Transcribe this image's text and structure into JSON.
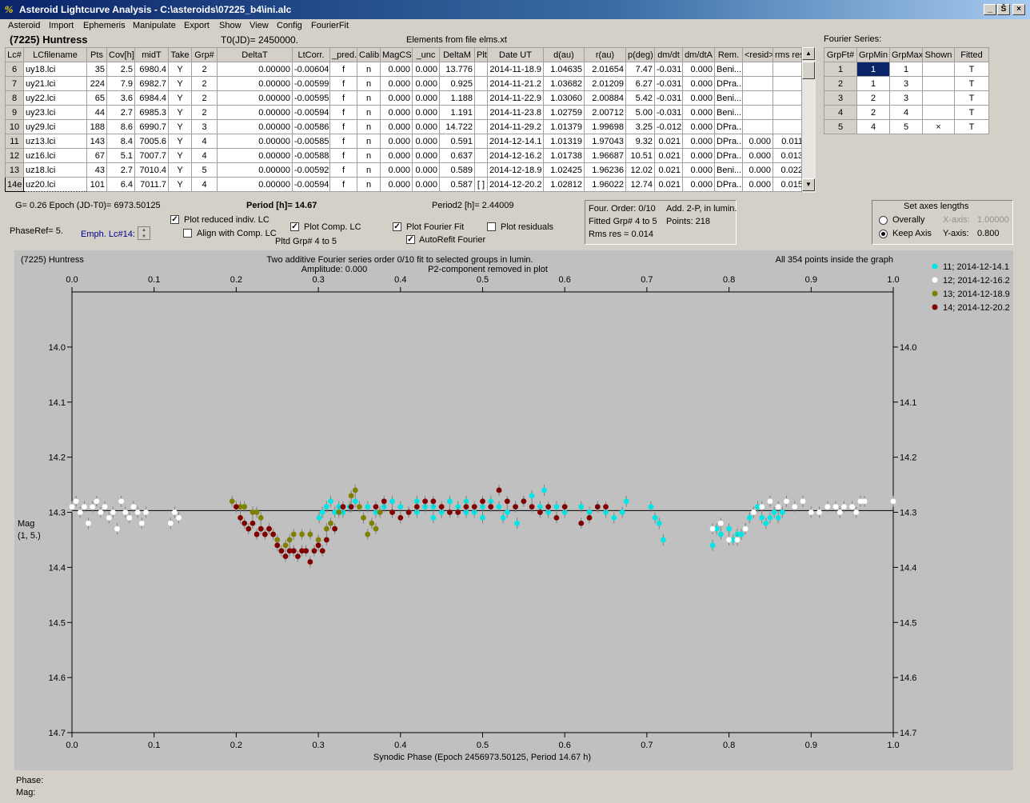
{
  "window": {
    "title": "Asteroid Lightcurve Analysis - C:\\asteroids\\07225_b4\\ini.alc",
    "icon": "app-icon",
    "controls": [
      "_",
      "Š",
      "×"
    ]
  },
  "menu": [
    "Asteroid",
    "Import",
    "Ephemeris",
    "Manipulate",
    "Export",
    "Show",
    "View",
    "Config",
    "FourierFit"
  ],
  "header": {
    "asteroid": "(7225) Huntress",
    "t0": "T0(JD)= 2450000.",
    "elements": "Elements from file elms.xt",
    "fourier_label": "Fourier Series:"
  },
  "lc_table": {
    "columns": [
      "Lc#",
      "LCfilename",
      "Pts",
      "Cov[h]",
      "midT",
      "Take",
      "Grp#",
      "DeltaT",
      "LtCorr.",
      "_pred.",
      "Calib.",
      "MagCS",
      "_unc",
      "DeltaM",
      "Plt",
      "Date UT",
      "d(au)",
      "r(au)",
      "p(deg)",
      "dm/dt",
      "dm/dtA",
      "Rem.",
      "<resid>",
      "rms res"
    ],
    "rows": [
      [
        "6",
        "uy18.lci",
        "35",
        "2.5",
        "6980.4",
        "Y",
        "2",
        "0.00000",
        "-0.00604",
        "f",
        "n",
        "0.000",
        "0.000",
        "13.776",
        "",
        "2014-11-18.9",
        "1.04635",
        "2.01654",
        "7.47",
        "-0.031",
        "0.000",
        "Beni...",
        "",
        ""
      ],
      [
        "7",
        "uy21.lci",
        "224",
        "7.9",
        "6982.7",
        "Y",
        "2",
        "0.00000",
        "-0.00599",
        "f",
        "n",
        "0.000",
        "0.000",
        "0.925",
        "",
        "2014-11-21.2",
        "1.03682",
        "2.01209",
        "6.27",
        "-0.031",
        "0.000",
        "DPra...",
        "",
        ""
      ],
      [
        "8",
        "uy22.lci",
        "65",
        "3.6",
        "6984.4",
        "Y",
        "2",
        "0.00000",
        "-0.00595",
        "f",
        "n",
        "0.000",
        "0.000",
        "1.188",
        "",
        "2014-11-22.9",
        "1.03060",
        "2.00884",
        "5.42",
        "-0.031",
        "0.000",
        "Beni...",
        "",
        ""
      ],
      [
        "9",
        "uy23.lci",
        "44",
        "2.7",
        "6985.3",
        "Y",
        "2",
        "0.00000",
        "-0.00594",
        "f",
        "n",
        "0.000",
        "0.000",
        "1.191",
        "",
        "2014-11-23.8",
        "1.02759",
        "2.00712",
        "5.00",
        "-0.031",
        "0.000",
        "Beni...",
        "",
        ""
      ],
      [
        "10",
        "uy29.lci",
        "188",
        "8.6",
        "6990.7",
        "Y",
        "3",
        "0.00000",
        "-0.00586",
        "f",
        "n",
        "0.000",
        "0.000",
        "14.722",
        "",
        "2014-11-29.2",
        "1.01379",
        "1.99698",
        "3.25",
        "-0.012",
        "0.000",
        "DPra...",
        "",
        ""
      ],
      [
        "11",
        "uz13.lci",
        "143",
        "8.4",
        "7005.6",
        "Y",
        "4",
        "0.00000",
        "-0.00585",
        "f",
        "n",
        "0.000",
        "0.000",
        "0.591",
        "",
        "2014-12-14.1",
        "1.01319",
        "1.97043",
        "9.32",
        "0.021",
        "0.000",
        "DPra...",
        "0.000",
        "0.011"
      ],
      [
        "12",
        "uz16.lci",
        "67",
        "5.1",
        "7007.7",
        "Y",
        "4",
        "0.00000",
        "-0.00588",
        "f",
        "n",
        "0.000",
        "0.000",
        "0.637",
        "",
        "2014-12-16.2",
        "1.01738",
        "1.96687",
        "10.51",
        "0.021",
        "0.000",
        "DPra...",
        "0.000",
        "0.013"
      ],
      [
        "13",
        "uz18.lci",
        "43",
        "2.7",
        "7010.4",
        "Y",
        "5",
        "0.00000",
        "-0.00592",
        "f",
        "n",
        "0.000",
        "0.000",
        "0.589",
        "",
        "2014-12-18.9",
        "1.02425",
        "1.96236",
        "12.02",
        "0.021",
        "0.000",
        "Beni...",
        "0.000",
        "0.022"
      ],
      [
        "14e",
        "uz20.lci",
        "101",
        "6.4",
        "7011.7",
        "Y",
        "4",
        "0.00000",
        "-0.00594",
        "f",
        "n",
        "0.000",
        "0.000",
        "0.587",
        "[ ]",
        "2014-12-20.2",
        "1.02812",
        "1.96022",
        "12.74",
        "0.021",
        "0.000",
        "DPra...",
        "0.000",
        "0.015"
      ]
    ]
  },
  "fourier_table": {
    "columns": [
      "GrpFt#",
      "GrpMin",
      "GrpMax",
      "Shown",
      "Fitted"
    ],
    "rows": [
      [
        "1",
        "1",
        "1",
        "",
        "T"
      ],
      [
        "2",
        "1",
        "3",
        "",
        "T"
      ],
      [
        "3",
        "2",
        "3",
        "",
        "T"
      ],
      [
        "4",
        "2",
        "4",
        "",
        "T"
      ],
      [
        "5",
        "4",
        "5",
        "×",
        "T"
      ]
    ]
  },
  "controls": {
    "g_epoch": "G= 0.26   Epoch (JD-T0)= 6973.50125",
    "period": "Period [h]= 14.67",
    "period2": "Period2 [h]= 2.44009",
    "phaseref": "PhaseRef= 5.",
    "emph": "Emph. Lc#14:",
    "plot_reduced": "Plot reduced indiv. LC",
    "align_comp": "Align with Comp. LC",
    "plot_comp": "Plot Comp. LC",
    "pltd_grp": "Pltd Grp#  4   to   5",
    "plot_fourier": "Plot Fourier Fit",
    "autorefit": "AutoRefit Fourier",
    "plot_residuals": "Plot residuals",
    "plot_reduced_checked": true,
    "align_comp_checked": false,
    "plot_comp_checked": true,
    "plot_fourier_checked": true,
    "autorefit_checked": true,
    "plot_residuals_checked": false
  },
  "fit_info": {
    "order": "Four. Order:  0/10",
    "add": "Add. 2-P, in lumin.",
    "fitted": "Fitted Grp# 4 to 5",
    "points": "Points: 218",
    "rms": "Rms res     = 0.014"
  },
  "axes_panel": {
    "title": "Set axes lengths",
    "overally": "Overally",
    "keep": "Keep Axis",
    "xaxis_label": "X-axis:",
    "xaxis_value": "1.00000",
    "yaxis_label": "Y-axis:",
    "yaxis_value": "0.800",
    "selected": "Keep Axis"
  },
  "footer": {
    "phase": "Phase:",
    "mag": "Mag:"
  },
  "chart_data": {
    "type": "scatter",
    "title": "Two additive Fourier series order 0/10 fit to selected groups in lumin.",
    "subtitle_lines": [
      "Amplitude: 0.000",
      "P2-component removed in plot"
    ],
    "left_title": "(7225) Huntress",
    "right_title": "All 354 points inside the graph",
    "xlabel": "Synodic Phase (Epoch 2456973.50125, Period 14.67 h)",
    "ylabel": "Mag",
    "ylabel_sub": "(1, 5.)",
    "xlim": [
      0.0,
      1.0
    ],
    "ylim": [
      13.9,
      14.7
    ],
    "y_inverted": true,
    "x_ticks": [
      "0.0",
      "0.1",
      "0.2",
      "0.3",
      "0.4",
      "0.5",
      "0.6",
      "0.7",
      "0.8",
      "0.9",
      "1.0"
    ],
    "y_ticks": [
      "14.0",
      "14.1",
      "14.2",
      "14.3",
      "14.4",
      "14.5",
      "14.6",
      "14.7"
    ],
    "fit_line_y": 14.297,
    "background": "#c0c0c0",
    "legend_position": "right",
    "series": [
      {
        "name": "11; 2014-12-14.1",
        "color": "#00e5e5",
        "points": [
          [
            0.301,
            14.31
          ],
          [
            0.305,
            14.3
          ],
          [
            0.31,
            14.29
          ],
          [
            0.315,
            14.28
          ],
          [
            0.32,
            14.3
          ],
          [
            0.325,
            14.29
          ],
          [
            0.33,
            14.3
          ],
          [
            0.338,
            14.29
          ],
          [
            0.345,
            14.28
          ],
          [
            0.36,
            14.29
          ],
          [
            0.37,
            14.3
          ],
          [
            0.38,
            14.29
          ],
          [
            0.39,
            14.28
          ],
          [
            0.4,
            14.29
          ],
          [
            0.41,
            14.3
          ],
          [
            0.42,
            14.28
          ],
          [
            0.43,
            14.29
          ],
          [
            0.44,
            14.29
          ],
          [
            0.45,
            14.3
          ],
          [
            0.46,
            14.28
          ],
          [
            0.47,
            14.29
          ],
          [
            0.48,
            14.3
          ],
          [
            0.49,
            14.3
          ],
          [
            0.5,
            14.29
          ],
          [
            0.51,
            14.28
          ],
          [
            0.52,
            14.29
          ],
          [
            0.53,
            14.3
          ],
          [
            0.54,
            14.29
          ],
          [
            0.55,
            14.28
          ],
          [
            0.56,
            14.27
          ],
          [
            0.57,
            14.29
          ],
          [
            0.58,
            14.3
          ],
          [
            0.59,
            14.29
          ],
          [
            0.6,
            14.3
          ],
          [
            0.62,
            14.29
          ],
          [
            0.63,
            14.3
          ],
          [
            0.64,
            14.29
          ],
          [
            0.65,
            14.3
          ],
          [
            0.66,
            14.31
          ],
          [
            0.67,
            14.3
          ],
          [
            0.675,
            14.28
          ],
          [
            0.705,
            14.29
          ],
          [
            0.71,
            14.31
          ],
          [
            0.715,
            14.32
          ],
          [
            0.72,
            14.35
          ],
          [
            0.78,
            14.36
          ],
          [
            0.785,
            14.33
          ],
          [
            0.79,
            14.34
          ],
          [
            0.8,
            14.33
          ],
          [
            0.805,
            14.35
          ],
          [
            0.81,
            14.34
          ],
          [
            0.815,
            14.34
          ],
          [
            0.82,
            14.33
          ],
          [
            0.825,
            14.31
          ],
          [
            0.83,
            14.3
          ],
          [
            0.835,
            14.29
          ],
          [
            0.84,
            14.31
          ],
          [
            0.845,
            14.32
          ],
          [
            0.85,
            14.31
          ],
          [
            0.855,
            14.3
          ],
          [
            0.86,
            14.31
          ],
          [
            0.865,
            14.3
          ],
          [
            0.542,
            14.32
          ],
          [
            0.525,
            14.31
          ],
          [
            0.5,
            14.31
          ],
          [
            0.48,
            14.28
          ],
          [
            0.575,
            14.26
          ],
          [
            0.44,
            14.31
          ],
          [
            0.42,
            14.3
          ]
        ]
      },
      {
        "name": "12; 2014-12-16.2",
        "color": "#ffffff",
        "points": [
          [
            0.0,
            14.29
          ],
          [
            0.005,
            14.28
          ],
          [
            0.01,
            14.3
          ],
          [
            0.015,
            14.29
          ],
          [
            0.02,
            14.32
          ],
          [
            0.025,
            14.29
          ],
          [
            0.03,
            14.28
          ],
          [
            0.035,
            14.3
          ],
          [
            0.04,
            14.29
          ],
          [
            0.045,
            14.31
          ],
          [
            0.05,
            14.3
          ],
          [
            0.055,
            14.33
          ],
          [
            0.06,
            14.28
          ],
          [
            0.065,
            14.3
          ],
          [
            0.07,
            14.31
          ],
          [
            0.075,
            14.29
          ],
          [
            0.08,
            14.3
          ],
          [
            0.085,
            14.32
          ],
          [
            0.09,
            14.3
          ],
          [
            0.12,
            14.32
          ],
          [
            0.125,
            14.3
          ],
          [
            0.13,
            14.31
          ],
          [
            0.78,
            14.33
          ],
          [
            0.79,
            14.32
          ],
          [
            0.8,
            14.35
          ],
          [
            0.81,
            14.35
          ],
          [
            0.82,
            14.33
          ],
          [
            0.83,
            14.3
          ],
          [
            0.84,
            14.29
          ],
          [
            0.85,
            14.28
          ],
          [
            0.86,
            14.29
          ],
          [
            0.87,
            14.28
          ],
          [
            0.88,
            14.29
          ],
          [
            0.89,
            14.28
          ],
          [
            0.9,
            14.3
          ],
          [
            0.91,
            14.3
          ],
          [
            0.92,
            14.29
          ],
          [
            0.93,
            14.29
          ],
          [
            0.935,
            14.3
          ],
          [
            0.94,
            14.29
          ],
          [
            0.95,
            14.29
          ],
          [
            0.955,
            14.3
          ],
          [
            0.96,
            14.28
          ],
          [
            0.965,
            14.28
          ],
          [
            1.0,
            14.28
          ]
        ]
      },
      {
        "name": "13; 2014-12-18.9",
        "color": "#808000",
        "points": [
          [
            0.195,
            14.28
          ],
          [
            0.205,
            14.29
          ],
          [
            0.21,
            14.29
          ],
          [
            0.22,
            14.3
          ],
          [
            0.225,
            14.3
          ],
          [
            0.23,
            14.31
          ],
          [
            0.24,
            14.33
          ],
          [
            0.25,
            14.35
          ],
          [
            0.26,
            14.36
          ],
          [
            0.265,
            14.35
          ],
          [
            0.27,
            14.34
          ],
          [
            0.28,
            14.34
          ],
          [
            0.29,
            14.34
          ],
          [
            0.3,
            14.35
          ],
          [
            0.31,
            14.33
          ],
          [
            0.315,
            14.32
          ],
          [
            0.325,
            14.3
          ],
          [
            0.33,
            14.29
          ],
          [
            0.34,
            14.27
          ],
          [
            0.345,
            14.26
          ],
          [
            0.35,
            14.29
          ],
          [
            0.355,
            14.31
          ],
          [
            0.36,
            14.34
          ],
          [
            0.365,
            14.32
          ],
          [
            0.37,
            14.33
          ],
          [
            0.375,
            14.3
          ]
        ]
      },
      {
        "name": "14; 2014-12-20.2",
        "color": "#800000",
        "points": [
          [
            0.2,
            14.29
          ],
          [
            0.205,
            14.31
          ],
          [
            0.21,
            14.32
          ],
          [
            0.215,
            14.33
          ],
          [
            0.22,
            14.32
          ],
          [
            0.225,
            14.34
          ],
          [
            0.23,
            14.33
          ],
          [
            0.235,
            14.34
          ],
          [
            0.24,
            14.33
          ],
          [
            0.245,
            14.34
          ],
          [
            0.25,
            14.36
          ],
          [
            0.255,
            14.37
          ],
          [
            0.26,
            14.38
          ],
          [
            0.265,
            14.37
          ],
          [
            0.27,
            14.37
          ],
          [
            0.275,
            14.38
          ],
          [
            0.28,
            14.37
          ],
          [
            0.285,
            14.37
          ],
          [
            0.29,
            14.39
          ],
          [
            0.295,
            14.37
          ],
          [
            0.3,
            14.36
          ],
          [
            0.305,
            14.37
          ],
          [
            0.31,
            14.35
          ],
          [
            0.32,
            14.33
          ],
          [
            0.33,
            14.29
          ],
          [
            0.34,
            14.29
          ],
          [
            0.37,
            14.29
          ],
          [
            0.38,
            14.28
          ],
          [
            0.39,
            14.3
          ],
          [
            0.4,
            14.31
          ],
          [
            0.41,
            14.3
          ],
          [
            0.42,
            14.29
          ],
          [
            0.43,
            14.28
          ],
          [
            0.44,
            14.28
          ],
          [
            0.45,
            14.29
          ],
          [
            0.46,
            14.3
          ],
          [
            0.47,
            14.3
          ],
          [
            0.48,
            14.29
          ],
          [
            0.49,
            14.29
          ],
          [
            0.5,
            14.28
          ],
          [
            0.51,
            14.29
          ],
          [
            0.52,
            14.26
          ],
          [
            0.53,
            14.28
          ],
          [
            0.54,
            14.29
          ],
          [
            0.55,
            14.28
          ],
          [
            0.56,
            14.29
          ],
          [
            0.57,
            14.3
          ],
          [
            0.58,
            14.29
          ],
          [
            0.59,
            14.31
          ],
          [
            0.6,
            14.29
          ],
          [
            0.62,
            14.32
          ],
          [
            0.63,
            14.31
          ],
          [
            0.64,
            14.29
          ],
          [
            0.65,
            14.29
          ]
        ]
      }
    ]
  }
}
